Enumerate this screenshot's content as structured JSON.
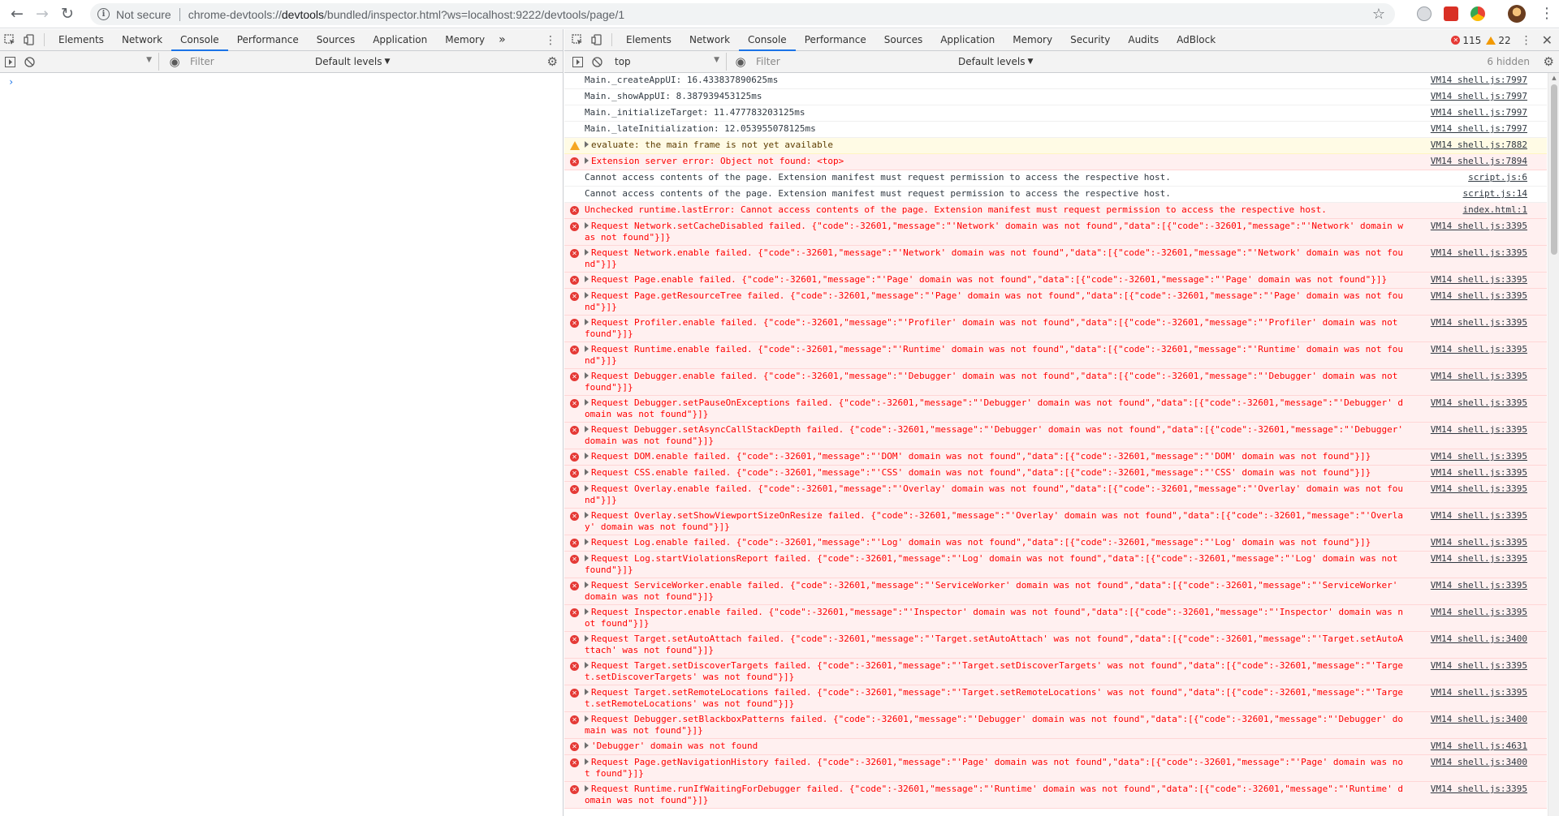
{
  "browser": {
    "not_secure": "Not secure",
    "url_scheme": "chrome-devtools://",
    "url_host": "devtools",
    "url_path": "/bundled/inspector.html?ws=localhost:9222/devtools/page/1"
  },
  "left": {
    "tabs": [
      "Elements",
      "Network",
      "Console",
      "Performance",
      "Sources",
      "Application",
      "Memory"
    ],
    "active_tab": "Console",
    "more": "»",
    "filter_placeholder": "Filter",
    "levels": "Default levels",
    "prompt": "›"
  },
  "right": {
    "tabs": [
      "Elements",
      "Network",
      "Console",
      "Performance",
      "Sources",
      "Application",
      "Memory",
      "Security",
      "Audits",
      "AdBlock"
    ],
    "active_tab": "Console",
    "error_count": "115",
    "warning_count": "22",
    "context": "top",
    "filter_placeholder": "Filter",
    "levels": "Default levels",
    "hidden": "6 hidden"
  },
  "messages": [
    {
      "level": "info",
      "text": "Main._createAppUI: 16.433837890625ms",
      "src": "VM14 shell.js:7997",
      "expand": false
    },
    {
      "level": "info",
      "text": "Main._showAppUI: 8.387939453125ms",
      "src": "VM14 shell.js:7997",
      "expand": false
    },
    {
      "level": "info",
      "text": "Main._initializeTarget: 11.477783203125ms",
      "src": "VM14 shell.js:7997",
      "expand": false
    },
    {
      "level": "info",
      "text": "Main._lateInitialization: 12.053955078125ms",
      "src": "VM14 shell.js:7997",
      "expand": false
    },
    {
      "level": "warning",
      "text": "evaluate: the main frame is not yet available",
      "src": "VM14 shell.js:7882",
      "expand": true
    },
    {
      "level": "error",
      "text": "Extension server error: Object not found: <top>",
      "src": "VM14 shell.js:7894",
      "expand": true
    },
    {
      "level": "info",
      "text": "Cannot access contents of the page. Extension manifest must request permission to access the respective host.",
      "src": "script.js:6",
      "expand": false
    },
    {
      "level": "info",
      "text": "Cannot access contents of the page. Extension manifest must request permission to access the respective host.",
      "src": "script.js:14",
      "expand": false
    },
    {
      "level": "error",
      "text": "Unchecked runtime.lastError: Cannot access contents of the page. Extension manifest must request permission to access the respective host.",
      "src": "index.html:1",
      "expand": false
    },
    {
      "level": "error",
      "text": "Request Network.setCacheDisabled failed. {\"code\":-32601,\"message\":\"'Network' domain was not found\",\"data\":[{\"code\":-32601,\"message\":\"'Network' domain was not found\"}]}",
      "src": "VM14 shell.js:3395",
      "expand": true
    },
    {
      "level": "error",
      "text": "Request Network.enable failed. {\"code\":-32601,\"message\":\"'Network' domain was not found\",\"data\":[{\"code\":-32601,\"message\":\"'Network' domain was not found\"}]}",
      "src": "VM14 shell.js:3395",
      "expand": true
    },
    {
      "level": "error",
      "text": "Request Page.enable failed. {\"code\":-32601,\"message\":\"'Page' domain was not found\",\"data\":[{\"code\":-32601,\"message\":\"'Page' domain was not found\"}]}",
      "src": "VM14 shell.js:3395",
      "expand": true
    },
    {
      "level": "error",
      "text": "Request Page.getResourceTree failed. {\"code\":-32601,\"message\":\"'Page' domain was not found\",\"data\":[{\"code\":-32601,\"message\":\"'Page' domain was not found\"}]}",
      "src": "VM14 shell.js:3395",
      "expand": true
    },
    {
      "level": "error",
      "text": "Request Profiler.enable failed. {\"code\":-32601,\"message\":\"'Profiler' domain was not found\",\"data\":[{\"code\":-32601,\"message\":\"'Profiler' domain was not found\"}]}",
      "src": "VM14 shell.js:3395",
      "expand": true
    },
    {
      "level": "error",
      "text": "Request Runtime.enable failed. {\"code\":-32601,\"message\":\"'Runtime' domain was not found\",\"data\":[{\"code\":-32601,\"message\":\"'Runtime' domain was not found\"}]}",
      "src": "VM14 shell.js:3395",
      "expand": true
    },
    {
      "level": "error",
      "text": "Request Debugger.enable failed. {\"code\":-32601,\"message\":\"'Debugger' domain was not found\",\"data\":[{\"code\":-32601,\"message\":\"'Debugger' domain was not found\"}]}",
      "src": "VM14 shell.js:3395",
      "expand": true
    },
    {
      "level": "error",
      "text": "Request Debugger.setPauseOnExceptions failed. {\"code\":-32601,\"message\":\"'Debugger' domain was not found\",\"data\":[{\"code\":-32601,\"message\":\"'Debugger' domain was not found\"}]}",
      "src": "VM14 shell.js:3395",
      "expand": true
    },
    {
      "level": "error",
      "text": "Request Debugger.setAsyncCallStackDepth failed. {\"code\":-32601,\"message\":\"'Debugger' domain was not found\",\"data\":[{\"code\":-32601,\"message\":\"'Debugger' domain was not found\"}]}",
      "src": "VM14 shell.js:3395",
      "expand": true
    },
    {
      "level": "error",
      "text": "Request DOM.enable failed. {\"code\":-32601,\"message\":\"'DOM' domain was not found\",\"data\":[{\"code\":-32601,\"message\":\"'DOM' domain was not found\"}]}",
      "src": "VM14 shell.js:3395",
      "expand": true
    },
    {
      "level": "error",
      "text": "Request CSS.enable failed. {\"code\":-32601,\"message\":\"'CSS' domain was not found\",\"data\":[{\"code\":-32601,\"message\":\"'CSS' domain was not found\"}]}",
      "src": "VM14 shell.js:3395",
      "expand": true
    },
    {
      "level": "error",
      "text": "Request Overlay.enable failed. {\"code\":-32601,\"message\":\"'Overlay' domain was not found\",\"data\":[{\"code\":-32601,\"message\":\"'Overlay' domain was not found\"}]}",
      "src": "VM14 shell.js:3395",
      "expand": true
    },
    {
      "level": "error",
      "text": "Request Overlay.setShowViewportSizeOnResize failed. {\"code\":-32601,\"message\":\"'Overlay' domain was not found\",\"data\":[{\"code\":-32601,\"message\":\"'Overlay' domain was not found\"}]}",
      "src": "VM14 shell.js:3395",
      "expand": true
    },
    {
      "level": "error",
      "text": "Request Log.enable failed. {\"code\":-32601,\"message\":\"'Log' domain was not found\",\"data\":[{\"code\":-32601,\"message\":\"'Log' domain was not found\"}]}",
      "src": "VM14 shell.js:3395",
      "expand": true
    },
    {
      "level": "error",
      "text": "Request Log.startViolationsReport failed. {\"code\":-32601,\"message\":\"'Log' domain was not found\",\"data\":[{\"code\":-32601,\"message\":\"'Log' domain was not found\"}]}",
      "src": "VM14 shell.js:3395",
      "expand": true
    },
    {
      "level": "error",
      "text": "Request ServiceWorker.enable failed. {\"code\":-32601,\"message\":\"'ServiceWorker' domain was not found\",\"data\":[{\"code\":-32601,\"message\":\"'ServiceWorker' domain was not found\"}]}",
      "src": "VM14 shell.js:3395",
      "expand": true
    },
    {
      "level": "error",
      "text": "Request Inspector.enable failed. {\"code\":-32601,\"message\":\"'Inspector' domain was not found\",\"data\":[{\"code\":-32601,\"message\":\"'Inspector' domain was not found\"}]}",
      "src": "VM14 shell.js:3395",
      "expand": true
    },
    {
      "level": "error",
      "text": "Request Target.setAutoAttach failed. {\"code\":-32601,\"message\":\"'Target.setAutoAttach' was not found\",\"data\":[{\"code\":-32601,\"message\":\"'Target.setAutoAttach' was not found\"}]}",
      "src": "VM14 shell.js:3400",
      "expand": true
    },
    {
      "level": "error",
      "text": "Request Target.setDiscoverTargets failed. {\"code\":-32601,\"message\":\"'Target.setDiscoverTargets' was not found\",\"data\":[{\"code\":-32601,\"message\":\"'Target.setDiscoverTargets' was not found\"}]}",
      "src": "VM14 shell.js:3395",
      "expand": true
    },
    {
      "level": "error",
      "text": "Request Target.setRemoteLocations failed. {\"code\":-32601,\"message\":\"'Target.setRemoteLocations' was not found\",\"data\":[{\"code\":-32601,\"message\":\"'Target.setRemoteLocations' was not found\"}]}",
      "src": "VM14 shell.js:3395",
      "expand": true
    },
    {
      "level": "error",
      "text": "Request Debugger.setBlackboxPatterns failed. {\"code\":-32601,\"message\":\"'Debugger' domain was not found\",\"data\":[{\"code\":-32601,\"message\":\"'Debugger' domain was not found\"}]}",
      "src": "VM14 shell.js:3400",
      "expand": true
    },
    {
      "level": "error",
      "text": "'Debugger' domain was not found",
      "src": "VM14 shell.js:4631",
      "expand": true
    },
    {
      "level": "error",
      "text": "Request Page.getNavigationHistory failed. {\"code\":-32601,\"message\":\"'Page' domain was not found\",\"data\":[{\"code\":-32601,\"message\":\"'Page' domain was not found\"}]}",
      "src": "VM14 shell.js:3400",
      "expand": true
    },
    {
      "level": "error",
      "text": "Request Runtime.runIfWaitingForDebugger failed. {\"code\":-32601,\"message\":\"'Runtime' domain was not found\",\"data\":[{\"code\":-32601,\"message\":\"'Runtime' domain was not found\"}]}",
      "src": "VM14 shell.js:3395",
      "expand": true
    }
  ]
}
